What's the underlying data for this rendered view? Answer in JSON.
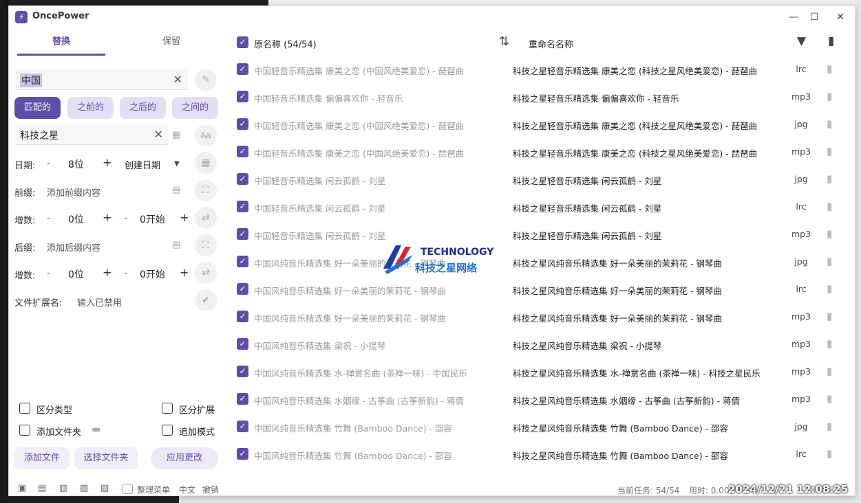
{
  "window": {
    "app_name": "OncePower",
    "logo_glyph": "⚡"
  },
  "left_panel": {
    "tabs": [
      {
        "label": "替换"
      },
      {
        "label": "保留"
      }
    ],
    "search_value": "中国",
    "match_modes": [
      "匹配的",
      "之前的",
      "之后的",
      "之间的"
    ],
    "replace_value": "科技之星",
    "date": {
      "label": "日期:",
      "digits": "8位",
      "type": "创建日期"
    },
    "prefix": {
      "label": "前缀:",
      "placeholder": "添加前缀内容"
    },
    "increment1": {
      "label": "增数:",
      "digits": "0位",
      "start": "0开始"
    },
    "suffix": {
      "label": "后缀:",
      "placeholder": "添加后缀内容"
    },
    "increment2": {
      "label": "增数:",
      "digits": "0位",
      "start": "0开始"
    },
    "extension": {
      "label": "文件扩展名:",
      "placeholder": "输入已禁用"
    },
    "options": {
      "distinguish_type": "区分类型",
      "distinguish_ext": "区分扩展",
      "add_folder": "添加文件夹",
      "append_mode": "追加模式"
    },
    "buttons": {
      "add_file": "添加文件",
      "select_folder": "选择文件夹",
      "apply": "应用更改"
    },
    "footer": {
      "organize_menu": "整理菜单",
      "language": "中文",
      "undo": "撤销"
    }
  },
  "right_panel": {
    "header": {
      "original_label": "原名称 (54/54)",
      "rename_label": "重命名名称"
    },
    "files": [
      {
        "orig": "中国轻音乐精选集 康美之恋 (中国风绝美爱恋) - 琵琶曲",
        "new": "科技之星轻音乐精选集 康美之恋 (科技之星风绝美爱恋) - 琵琶曲",
        "ext": "lrc"
      },
      {
        "orig": "中国轻音乐精选集 偏偏喜欢你 - 轻音乐",
        "new": "科技之星轻音乐精选集 偏偏喜欢你 - 轻音乐",
        "ext": "mp3"
      },
      {
        "orig": "中国轻音乐精选集 康美之恋 (中国风绝美爱恋) - 琵琶曲",
        "new": "科技之星轻音乐精选集 康美之恋 (科技之星风绝美爱恋) - 琵琶曲",
        "ext": "jpg"
      },
      {
        "orig": "中国轻音乐精选集 康美之恋 (中国风绝美爱恋) - 琵琶曲",
        "new": "科技之星轻音乐精选集 康美之恋 (科技之星风绝美爱恋) - 琵琶曲",
        "ext": "mp3"
      },
      {
        "orig": "中国轻音乐精选集 闲云孤鹤 - 刘星",
        "new": "科技之星轻音乐精选集 闲云孤鹤 - 刘星",
        "ext": "jpg"
      },
      {
        "orig": "中国轻音乐精选集 闲云孤鹤 - 刘星",
        "new": "科技之星轻音乐精选集 闲云孤鹤 - 刘星",
        "ext": "lrc"
      },
      {
        "orig": "中国轻音乐精选集 闲云孤鹤 - 刘星",
        "new": "科技之星轻音乐精选集 闲云孤鹤 - 刘星",
        "ext": "mp3"
      },
      {
        "orig": "中国风纯音乐精选集 好一朵美丽的茉莉花 - 钢琴曲",
        "new": "科技之星风纯音乐精选集 好一朵美丽的茉莉花 - 钢琴曲",
        "ext": "jpg"
      },
      {
        "orig": "中国风纯音乐精选集 好一朵美丽的茉莉花 - 钢琴曲",
        "new": "科技之星风纯音乐精选集 好一朵美丽的茉莉花 - 钢琴曲",
        "ext": "lrc"
      },
      {
        "orig": "中国风纯音乐精选集 好一朵美丽的茉莉花 - 钢琴曲",
        "new": "科技之星风纯音乐精选集 好一朵美丽的茉莉花 - 钢琴曲",
        "ext": "mp3"
      },
      {
        "orig": "中国风纯音乐精选集 梁祝 - 小提琴",
        "new": "科技之星风纯音乐精选集 梁祝 - 小提琴",
        "ext": "mp3"
      },
      {
        "orig": "中国风纯音乐精选集 水-禅意名曲 (茶禅一味) - 中国民乐",
        "new": "科技之星风纯音乐精选集 水-禅意名曲 (茶禅一味) - 科技之星民乐",
        "ext": "mp3"
      },
      {
        "orig": "中国风纯音乐精选集 水姻缘 - 古筝曲 (古筝新韵) - 蒋倩",
        "new": "科技之星风纯音乐精选集 水姻缘 - 古筝曲 (古筝新韵) - 蒋倩",
        "ext": "mp3"
      },
      {
        "orig": "中国风纯音乐精选集 竹舞 (Bamboo Dance) - 邵容",
        "new": "科技之星风纯音乐精选集 竹舞 (Bamboo Dance) - 邵容",
        "ext": "jpg"
      },
      {
        "orig": "中国风纯音乐精选集 竹舞 (Bamboo Dance) - 邵容",
        "new": "科技之星风纯音乐精选集 竹舞 (Bamboo Dance) - 邵容",
        "ext": "lrc"
      }
    ],
    "status": {
      "tasks": "当前任务: 54/54",
      "time": "用时: 0.00s"
    }
  },
  "watermark": {
    "en": "TECHNOLOGY",
    "cn": "科技之星网络"
  },
  "datestamp": "2024/12/21  12:08:25",
  "colors": {
    "accent": "#5b4fa8",
    "accent_light": "#e2def4"
  }
}
